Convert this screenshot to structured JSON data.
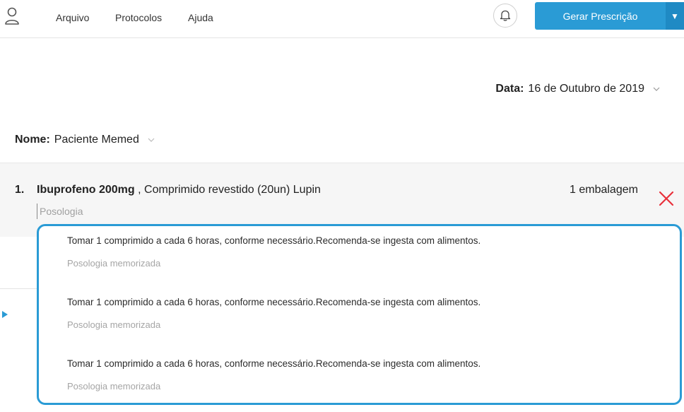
{
  "header": {
    "menu": [
      "Arquivo",
      "Protocolos",
      "Ajuda"
    ],
    "generate_button": "Gerar Prescrição"
  },
  "prescription": {
    "date_label": "Data:",
    "date_value": "16 de Outubro de 2019",
    "name_label": "Nome:",
    "name_value": "Paciente Memed"
  },
  "items": [
    {
      "number": "1.",
      "drug_name": "Ibuprofeno 200mg",
      "drug_details": ", Comprimido revestido (20un) Lupin",
      "quantity": "1 embalagem",
      "dosage_placeholder": "Posologia"
    }
  ],
  "suggestions": [
    {
      "text": "Tomar 1 comprimido a cada 6 horas, conforme necessário.Recomenda-se ingesta com alimentos.",
      "subtitle": "Posologia memorizada"
    },
    {
      "text": "Tomar 1 comprimido a cada 6 horas, conforme necessário.Recomenda-se ingesta com alimentos.",
      "subtitle": "Posologia memorizada"
    },
    {
      "text": "Tomar 1 comprimido a cada 6 horas, conforme necessário.Recomenda-se ingesta com alimentos.",
      "subtitle": "Posologia memorizada"
    }
  ],
  "icons": {
    "user": "user-icon",
    "bell": "bell-icon",
    "dropdown": "caret-down-icon",
    "remove": "close-icon",
    "chevron": "chevron-down-icon"
  },
  "colors": {
    "accent": "#2a9bd5",
    "remove": "#e8303b"
  }
}
